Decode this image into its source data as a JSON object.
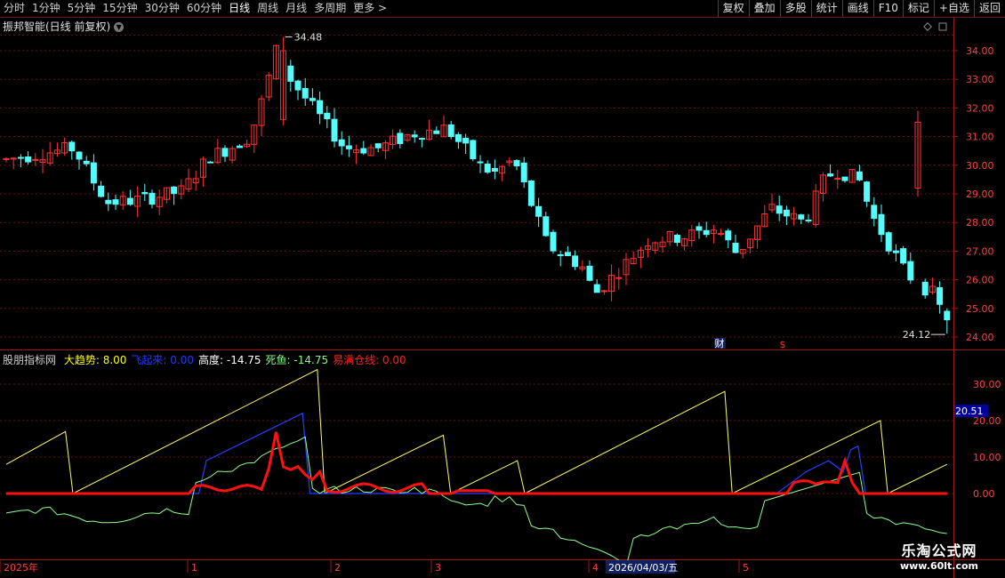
{
  "toolbar": {
    "periods": [
      "分时",
      "1分钟",
      "5分钟",
      "15分钟",
      "30分钟",
      "60分钟",
      "日线",
      "周线",
      "月线",
      "多周期",
      "更多 >"
    ],
    "active_period": "日线",
    "right_buttons": [
      "复权",
      "叠加",
      "多股",
      "统计",
      "画线",
      "F10",
      "标记",
      "+自选",
      "返回"
    ]
  },
  "stock": {
    "title": "振邦智能(日线 前复权)"
  },
  "price_panel": {
    "y_ticks": [
      "34.00",
      "33.00",
      "32.00",
      "31.00",
      "30.00",
      "29.00",
      "28.00",
      "27.00",
      "26.00",
      "25.00",
      "24.00"
    ],
    "high_label": "34.48",
    "low_label": "24.12",
    "markers": {
      "cai": "财",
      "dollar": "$"
    },
    "candle_up_color": "#ff3232",
    "candle_down_color": "#54fcfc"
  },
  "indicator": {
    "name": "股朋指标网",
    "items": [
      {
        "label": "大趋势:",
        "value": "8.00",
        "color": "#ffff00"
      },
      {
        "label": "飞起来:",
        "value": "0.00",
        "color": "#1e3cff"
      },
      {
        "label": "高度:",
        "value": "-14.75",
        "color": "#ffffff"
      },
      {
        "label": "死鱼:",
        "value": "-14.75",
        "color": "#80ff80"
      },
      {
        "label": "易满仓线:",
        "value": "0.00",
        "color": "#ff2020"
      }
    ],
    "y_ticks": [
      "30.00",
      "20.00",
      "10.00",
      "0.00"
    ],
    "current_value": "20.51"
  },
  "date_axis": {
    "labels": [
      "2025年",
      "1",
      "2",
      "3",
      "4",
      "5"
    ],
    "cursor_date": "2026/04/03/五"
  },
  "watermark": {
    "line1": "乐淘公式网",
    "line2": "www.60lt.com"
  }
}
